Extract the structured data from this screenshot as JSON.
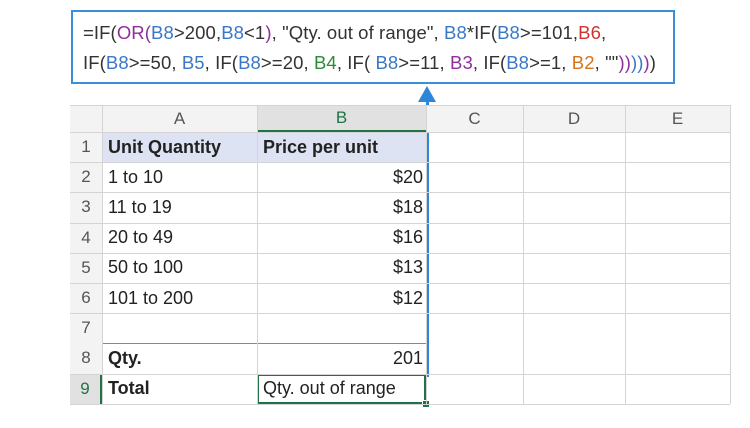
{
  "formula": {
    "line1": [
      {
        "t": "=IF(",
        "c": ""
      },
      {
        "t": "OR(",
        "c": "purple"
      },
      {
        "t": "B8",
        "c": "blue"
      },
      {
        "t": ">200,",
        "c": ""
      },
      {
        "t": "B8",
        "c": "blue"
      },
      {
        "t": "<1",
        "c": ""
      },
      {
        "t": ")",
        "c": "purple"
      },
      {
        "t": ", \"Qty. out of range\", ",
        "c": ""
      },
      {
        "t": "B8",
        "c": "blue"
      },
      {
        "t": "*IF(",
        "c": ""
      },
      {
        "t": "B8",
        "c": "blue"
      },
      {
        "t": ">=101,",
        "c": ""
      },
      {
        "t": "B6",
        "c": "red"
      },
      {
        "t": ",",
        "c": ""
      }
    ],
    "line2": [
      {
        "t": "IF(",
        "c": ""
      },
      {
        "t": "B8",
        "c": "blue"
      },
      {
        "t": ">=50, ",
        "c": ""
      },
      {
        "t": "B5",
        "c": "blue"
      },
      {
        "t": ", IF(",
        "c": ""
      },
      {
        "t": "B8",
        "c": "blue"
      },
      {
        "t": ">=20, ",
        "c": ""
      },
      {
        "t": "B4",
        "c": "green"
      },
      {
        "t": ", IF( ",
        "c": ""
      },
      {
        "t": "B8",
        "c": "blue"
      },
      {
        "t": ">=11, ",
        "c": ""
      },
      {
        "t": "B3",
        "c": "purple"
      },
      {
        "t": ", IF(",
        "c": ""
      },
      {
        "t": "B8",
        "c": "blue"
      },
      {
        "t": ">=1, ",
        "c": ""
      },
      {
        "t": "B2",
        "c": "orange"
      },
      {
        "t": ", \"\"",
        "c": ""
      },
      {
        "t": "))",
        "c": "purple"
      },
      {
        "t": "))",
        "c": "blue"
      },
      {
        "t": ")",
        "c": "purple"
      },
      {
        "t": ")",
        "c": ""
      }
    ]
  },
  "columns": [
    "A",
    "B",
    "C",
    "D",
    "E"
  ],
  "rows": [
    {
      "num": "1",
      "a": "Unit Quantity",
      "b": "Price per unit"
    },
    {
      "num": "2",
      "a": "1 to 10",
      "b": "$20"
    },
    {
      "num": "3",
      "a": "11 to 19",
      "b": "$18"
    },
    {
      "num": "4",
      "a": "20 to 49",
      "b": "$16"
    },
    {
      "num": "5",
      "a": "50 to 100",
      "b": "$13"
    },
    {
      "num": "6",
      "a": "101 to 200",
      "b": "$12"
    },
    {
      "num": "7",
      "a": "",
      "b": ""
    },
    {
      "num": "8",
      "a": "Qty.",
      "b": "201"
    },
    {
      "num": "9",
      "a": "Total",
      "b": "Qty. out of range"
    }
  ],
  "colors": {
    "accent": "#3b8fd9",
    "selection": "#217346",
    "header_band": "#dde3f2"
  }
}
